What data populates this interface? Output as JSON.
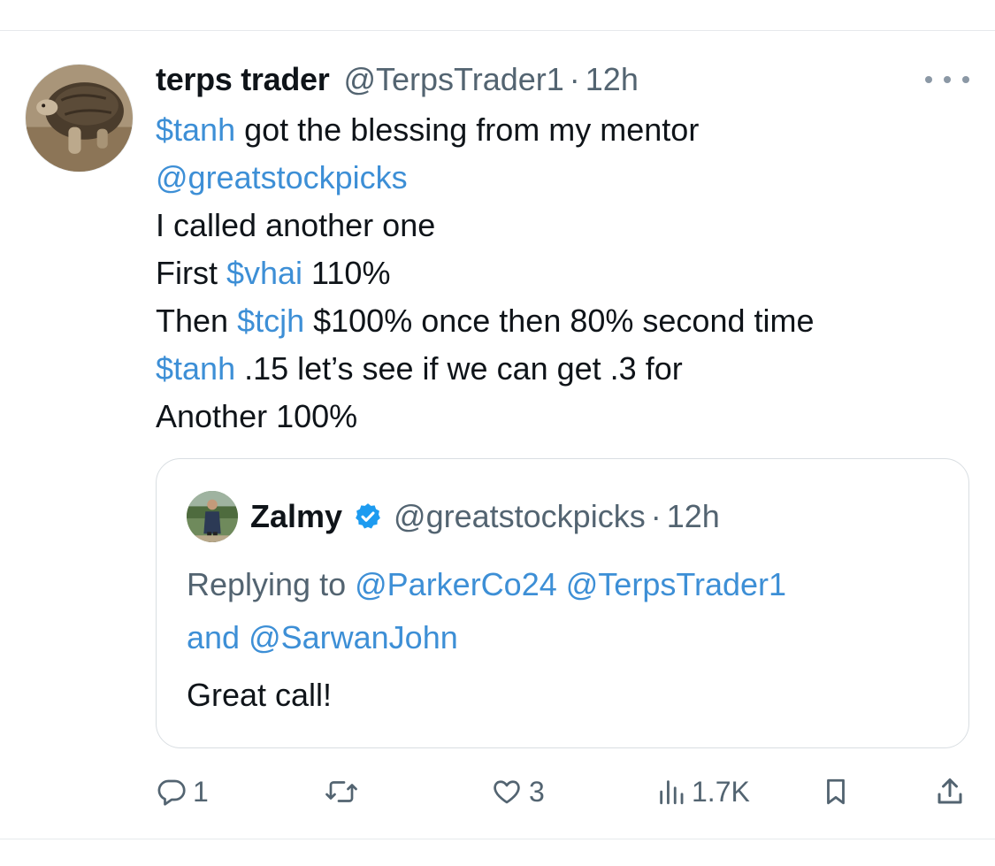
{
  "tweet": {
    "author_name": "terps trader",
    "author_handle": "@TerpsTrader1",
    "separator": "·",
    "time": "12h",
    "body": {
      "l1_link": "$tanh",
      "l1_text": " got the blessing from my mentor",
      "l2_link": "@greatstockpicks",
      "l3_text": "I called another one",
      "l4_text_a": "First ",
      "l4_link": "$vhai",
      "l4_text_b": " 110%",
      "l5_text_a": "Then ",
      "l5_link": "$tcjh",
      "l5_text_b": " $100% once then 80% second time",
      "l6_link": "$tanh",
      "l6_text": " .15 let’s see if we can get .3 for",
      "l7_text": "Another 100%"
    }
  },
  "quote": {
    "author_name": "Zalmy",
    "author_handle": "@greatstockpicks",
    "separator": "·",
    "time": "12h",
    "replying_prefix": "Replying to ",
    "reply_mention_1": "@ParkerCo24",
    "reply_mention_2": "@TerpsTrader1",
    "reply_and": "and ",
    "reply_mention_3": "@SarwanJohn",
    "text": "Great call!"
  },
  "actions": {
    "replies": "1",
    "retweets": "",
    "likes": "3",
    "views": "1.7K"
  },
  "colors": {
    "link": "#3d8fd6",
    "muted": "#536471",
    "verified": "#1d9bf0"
  },
  "icons": [
    "more-icon",
    "verified-badge-icon",
    "reply-icon",
    "retweet-icon",
    "like-icon",
    "views-icon",
    "bookmark-icon",
    "share-icon"
  ]
}
